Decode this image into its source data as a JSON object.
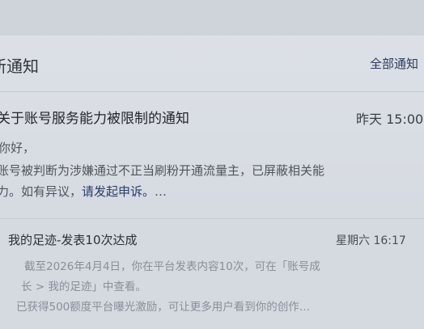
{
  "header": {
    "title": "新通知",
    "mark_all": "全部通知"
  },
  "notices": [
    {
      "title": "关于账号服务能力被限制的通知",
      "time": "昨天 15:00",
      "lines": [
        "你好，",
        "账号被判断为涉嫌通过不正当刷粉开通流量主，已屏蔽相关能",
        "力。如有异议，"
      ],
      "appeal_link": "请发起申诉。",
      "ellipsis": "…"
    },
    {
      "title": "我的足迹-发表10次达成",
      "time": "星期六 16:17",
      "lines": [
        "截至2026年4月4日，你在平台发表内容10次，可在「账号成",
        "长 > 我的足迹」中查看。",
        "已获得500额度平台曝光激励，可让更多用户看到你的创作…"
      ]
    }
  ]
}
